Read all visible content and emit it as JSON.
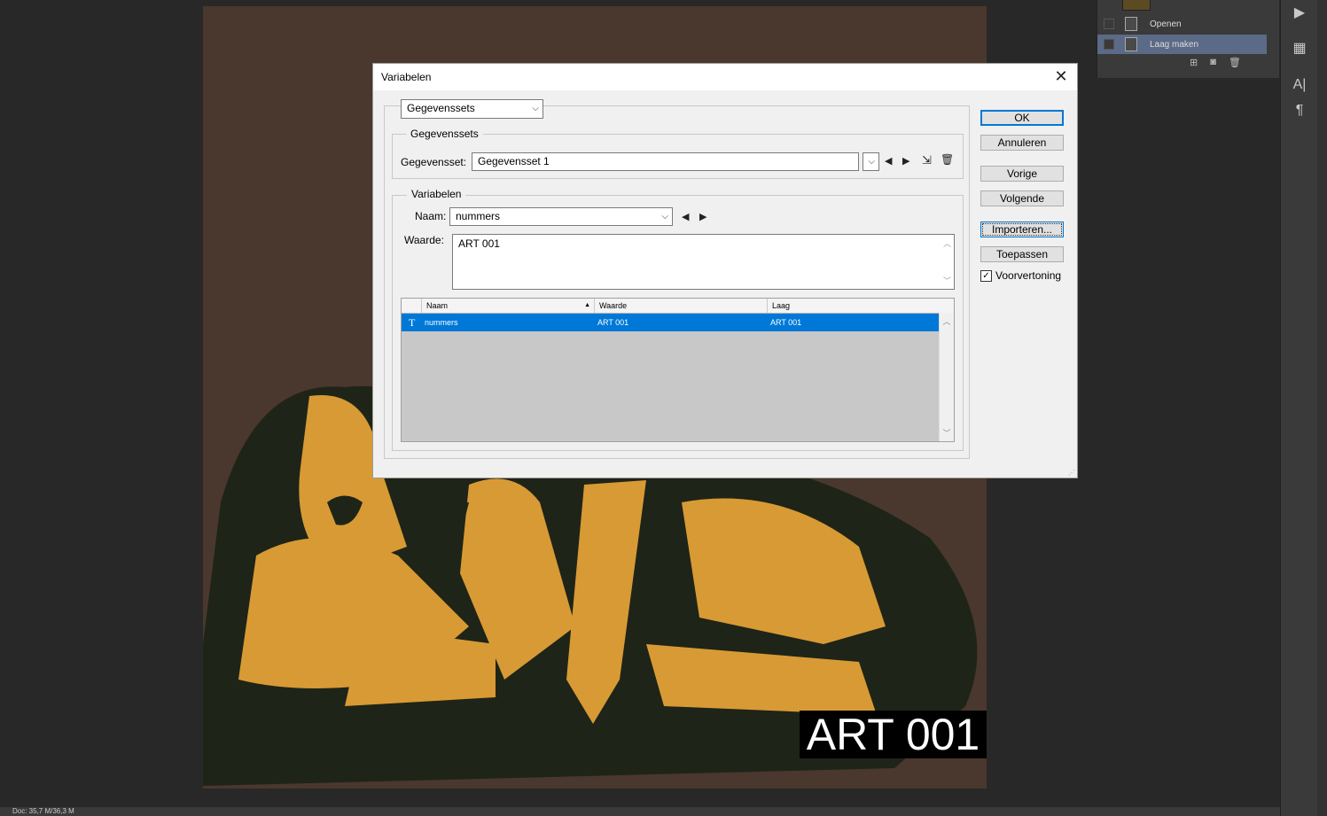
{
  "canvas": {
    "overlay_text": "ART 001"
  },
  "history": {
    "items": [
      {
        "label": "Openen",
        "selected": false
      },
      {
        "label": "Laag maken",
        "selected": true
      }
    ]
  },
  "status": {
    "doc_info": "Doc: 35,7 M/36,3 M"
  },
  "dialog": {
    "title": "Variabelen",
    "mode_select": "Gegevenssets",
    "datasets_group": {
      "label": "Gegevenssets",
      "field_label": "Gegevensset:",
      "value": "Gegevensset 1"
    },
    "variables_group": {
      "label": "Variabelen",
      "name_label": "Naam:",
      "name_value": "nummers",
      "value_label": "Waarde:",
      "value_text": "ART 001"
    },
    "table": {
      "columns": [
        "Naam",
        "Waarde",
        "Laag"
      ],
      "rows": [
        {
          "type_icon": "T",
          "name": "nummers",
          "value": "ART 001",
          "layer": "ART 001"
        }
      ]
    },
    "buttons": {
      "ok": "OK",
      "cancel": "Annuleren",
      "previous": "Vorige",
      "next": "Volgende",
      "import": "Importeren...",
      "apply": "Toepassen"
    },
    "preview": {
      "label": "Voorvertoning",
      "checked": true
    }
  }
}
